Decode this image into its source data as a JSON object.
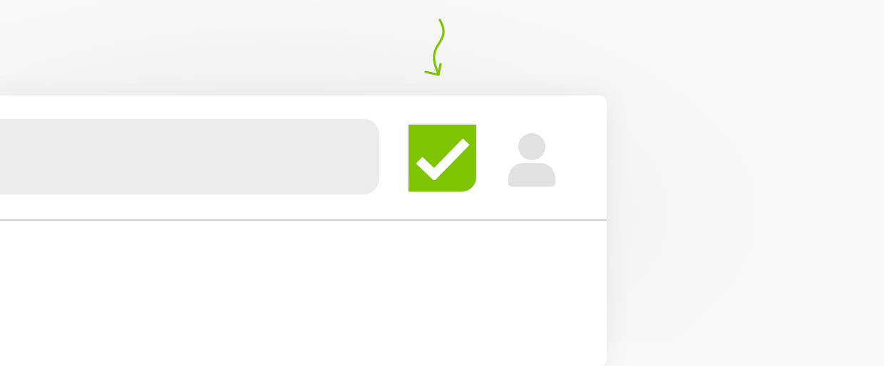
{
  "page": {
    "background": "#f8f8f8"
  },
  "annotation": {
    "icon": "hand-drawn-arrow-down-icon",
    "color": "#7cc500"
  },
  "toolbar": {
    "search_bar": {
      "value": "",
      "color": "#ececec"
    },
    "extension_button": {
      "icon": "checkmark-icon",
      "color": "#7cc500"
    },
    "avatar_button": {
      "icon": "user-avatar-icon",
      "color": "#e1e1e1"
    }
  },
  "content": {
    "background": "#ffffff"
  }
}
